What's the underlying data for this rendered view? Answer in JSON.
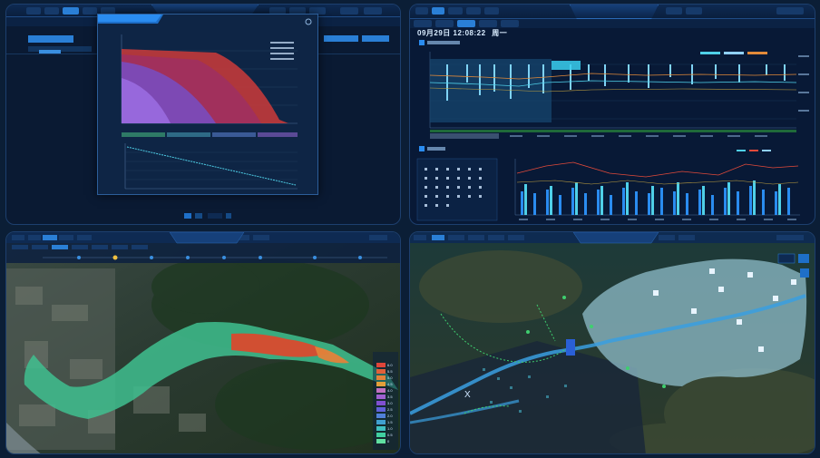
{
  "panel_top_right": {
    "datetime": "09月29日 12:08:22",
    "weekday": "周一",
    "main_tab_label": ""
  },
  "panel_bottom_left": {
    "title": "",
    "legend_values": [
      "6.0",
      "5.5",
      "5.0",
      "4.5",
      "4.0",
      "3.5",
      "3.0",
      "2.5",
      "2.0",
      "1.5",
      "1.0",
      "0.5",
      "0"
    ]
  },
  "panel_bottom_right": {
    "title": ""
  },
  "colors": {
    "accent": "#2a7fd6",
    "flood_red": "#d94a2e",
    "flood_green": "#3fbf8f",
    "water_blue": "#3a9fe0",
    "cyan": "#4fd0e8"
  }
}
